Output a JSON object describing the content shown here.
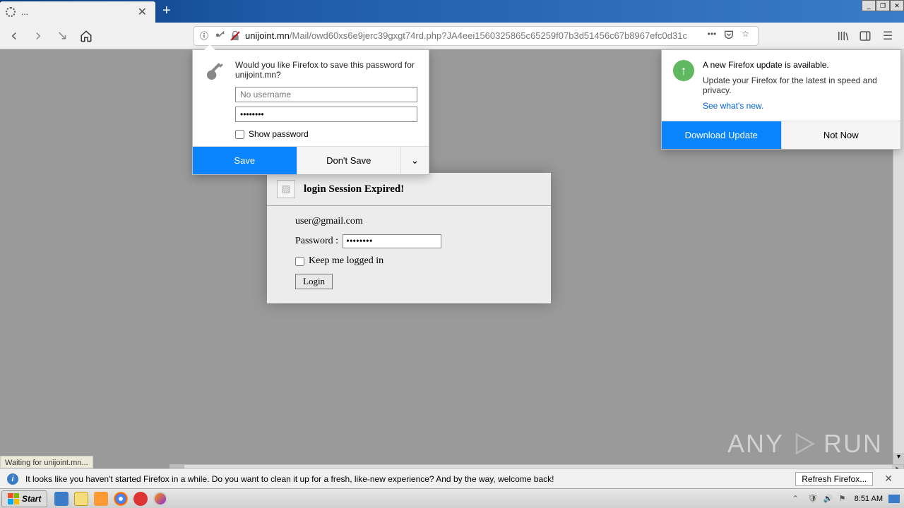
{
  "window": {
    "tab_title": "...",
    "minimize": "_",
    "maximize": "❐",
    "close": "✕"
  },
  "toolbar": {
    "url_domain": "unijoint.mn",
    "url_path": "/Mail/owd60xs6e9jerc39gxgt74rd.php?JA4eei1560325865c65259f07b3d51456c67b8967efc0d31c"
  },
  "save_password": {
    "message": "Would you like Firefox to save this password for unijoint.mn?",
    "username_placeholder": "No username",
    "password_value": "••••••••",
    "show_password": "Show password",
    "save": "Save",
    "dont_save": "Don't Save"
  },
  "update_popup": {
    "title": "A new Firefox update is available.",
    "desc": "Update your Firefox for the latest in speed and privacy.",
    "link": "See what's new.",
    "download": "Download Update",
    "not_now": "Not Now"
  },
  "login_card": {
    "title": "login Session Expired!",
    "email": "user@gmail.com",
    "password_label": "Password  :",
    "password_value": "••••••••",
    "keep_logged": "Keep me logged in",
    "login_btn": "Login"
  },
  "status": {
    "text": "Waiting for unijoint.mn..."
  },
  "info_bar": {
    "text": "It looks like you haven't started Firefox in a while. Do you want to clean it up for a fresh, like-new experience? And by the way, welcome back!",
    "refresh": "Refresh Firefox...",
    "close": "✕"
  },
  "taskbar": {
    "start": "Start",
    "time": "8:51 AM"
  },
  "watermark": {
    "text_left": "ANY",
    "text_right": "RUN"
  }
}
